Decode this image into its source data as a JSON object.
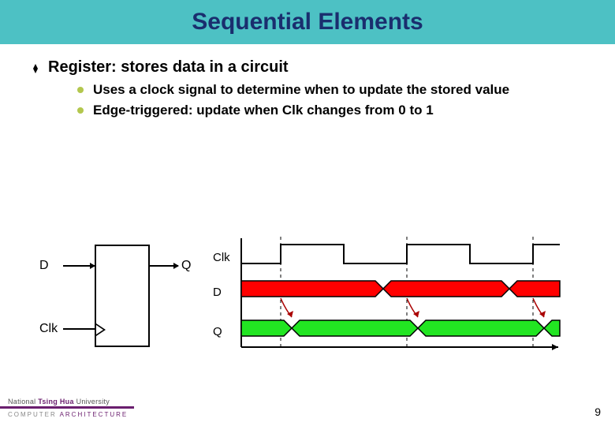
{
  "title": "Sequential Elements",
  "main_bullet": "Register: stores data in a circuit",
  "sub_bullets": [
    "Uses a clock signal to determine when to update the stored value",
    "Edge-triggered: update when Clk changes from 0 to 1"
  ],
  "labels": {
    "d": "D",
    "q": "Q",
    "clk": "Clk"
  },
  "timing_labels": {
    "clk": "Clk",
    "d": "D",
    "q": "Q"
  },
  "footer": {
    "university_prefix": "National ",
    "university_main": "Tsing Hua",
    "university_suffix": " University",
    "dept_a": "COMPUTER",
    "dept_b": "ARCHITECTURE"
  },
  "page_number": "9",
  "colors": {
    "header": "#4dc1c4",
    "title_text": "#1a2e6e",
    "sub_dot": "#b3c74e",
    "d_fill": "#ff0000",
    "q_fill": "#22e522",
    "accent": "#6a1e6e"
  }
}
